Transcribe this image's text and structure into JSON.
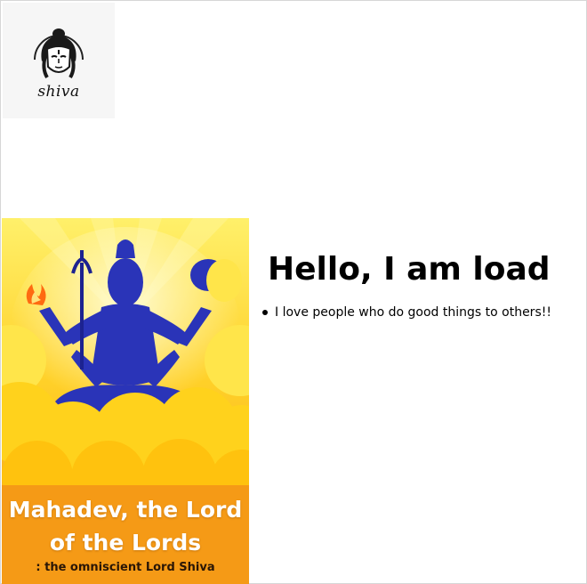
{
  "logo": {
    "text": "shiva",
    "icon": "shiva-face-icon"
  },
  "poster": {
    "title_line1": "Mahadev, the Lord",
    "title_line2": "of the Lords",
    "subtitle": ": the omniscient Lord Shiva",
    "colors": {
      "top": "#fff06a",
      "bottom": "#f59a16",
      "figure": "#2a34b8",
      "cloud": "#ffd21c"
    }
  },
  "main": {
    "heading": "Hello, I am load",
    "items": [
      "I love people who do good things to others!!"
    ]
  }
}
